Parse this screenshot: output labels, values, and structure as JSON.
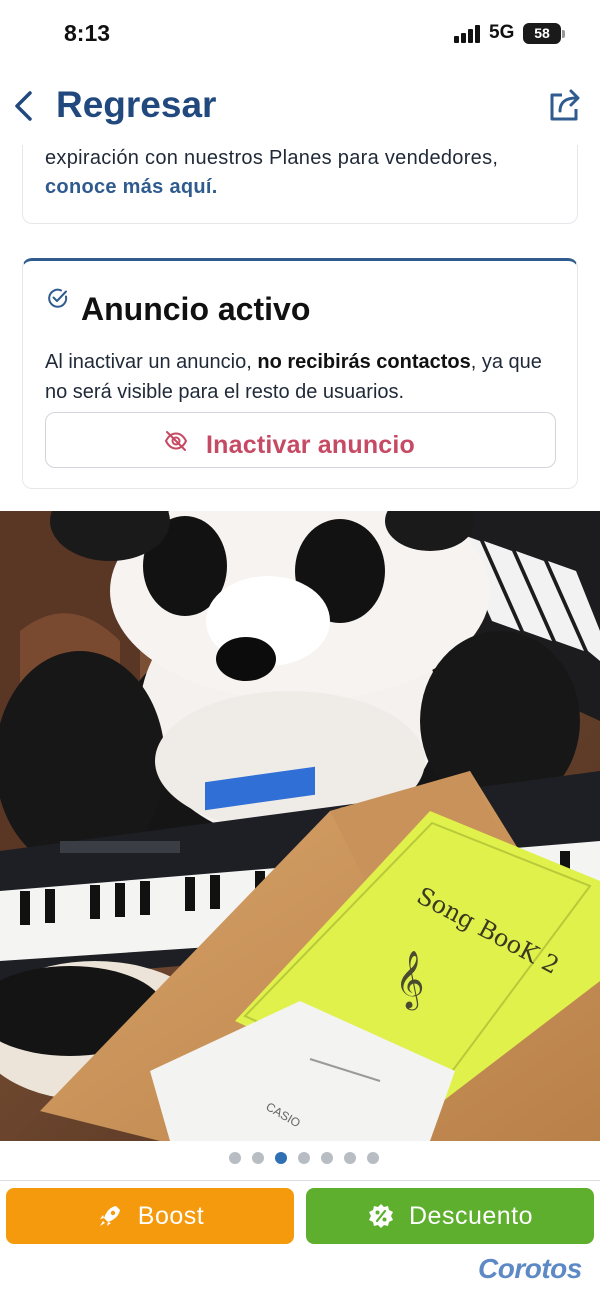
{
  "status_bar": {
    "time": "8:13",
    "network": "5G",
    "battery": "58",
    "battery_level": 0.58
  },
  "header": {
    "back_label": "Regresar",
    "back_icon": "chevron-left-icon",
    "share_icon": "share-icon",
    "title_color": "#21497d"
  },
  "plans_card": {
    "text": "expiración con nuestros Planes para vendedores,",
    "link": "conoce más aquí."
  },
  "active_card": {
    "title": "Anuncio activo",
    "desc_prefix": "Al inactivar un anuncio,",
    "desc_bold": "no recibirás contactos",
    "desc_suffix": ", ya que no será visible para el resto de usuarios.",
    "button_label": "Inactivar anuncio",
    "button_color": "#c64a63",
    "accent_color": "#2f5b8f"
  },
  "photo": {
    "book_title": "Song BooK 2",
    "brand_label": "CASIO"
  },
  "carousel": {
    "total": 7,
    "active_index": 2
  },
  "actions": {
    "boost_label": "Boost",
    "boost_color": "#f59a0c",
    "discount_label": "Descuento",
    "discount_color": "#5daf2d"
  },
  "brand": {
    "name": "Corotos"
  }
}
